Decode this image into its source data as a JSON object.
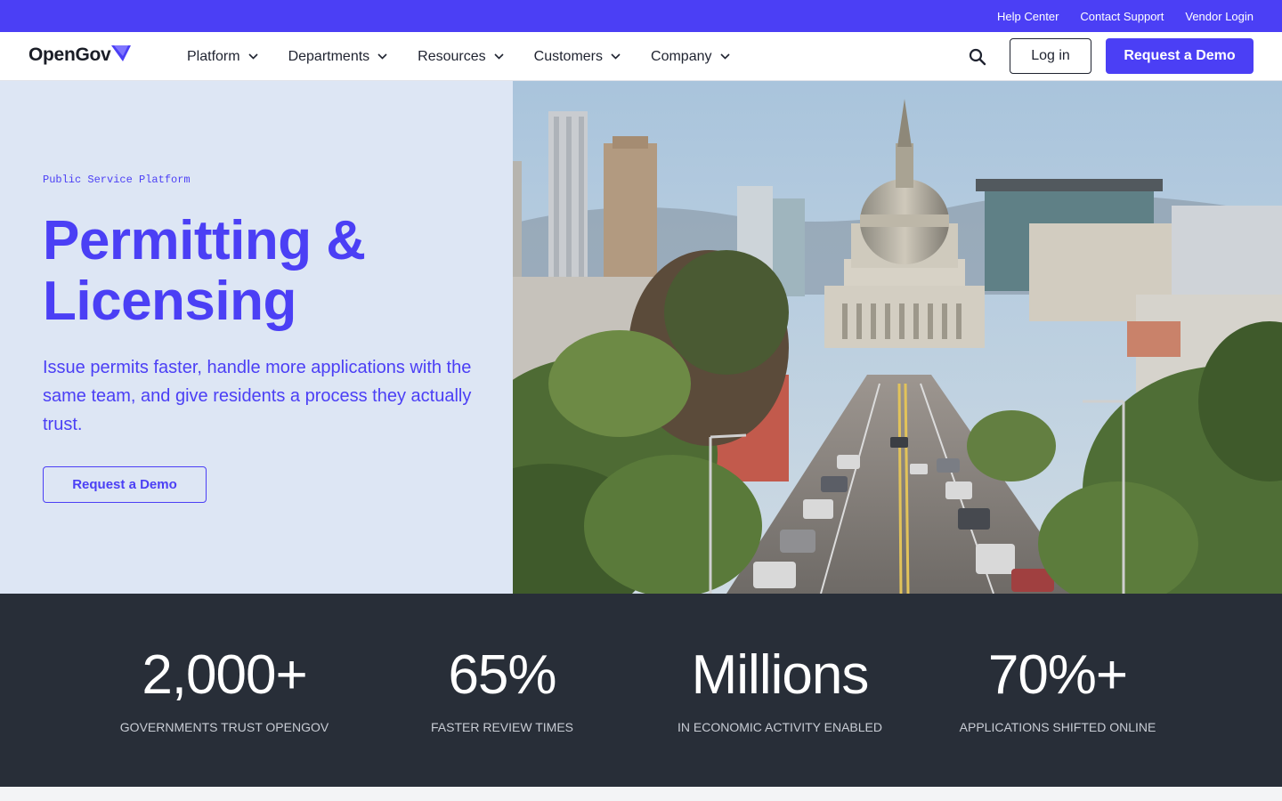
{
  "utility_nav": {
    "links": [
      "Help Center",
      "Contact Support",
      "Vendor Login"
    ]
  },
  "header": {
    "logo_text": "OpenGov",
    "nav_items": [
      "Platform",
      "Departments",
      "Resources",
      "Customers",
      "Company"
    ],
    "login_label": "Log in",
    "demo_label": "Request a Demo"
  },
  "hero": {
    "eyebrow": "Public Service Platform",
    "title": "Permitting & Licensing",
    "description": "Issue permits faster, handle more applications with the same team, and give residents a process they actually trust.",
    "cta_label": "Request a Demo"
  },
  "stats": [
    {
      "value": "2,000+",
      "label": "Governments trust OpenGov"
    },
    {
      "value": "65%",
      "label": "Faster review times"
    },
    {
      "value": "Millions",
      "label": "In economic activity enabled"
    },
    {
      "value": "70%+",
      "label": "Applications shifted online"
    }
  ],
  "colors": {
    "brand": "#4b3ff5",
    "hero_bg": "#dde6f4",
    "stats_bg": "#282e38"
  }
}
